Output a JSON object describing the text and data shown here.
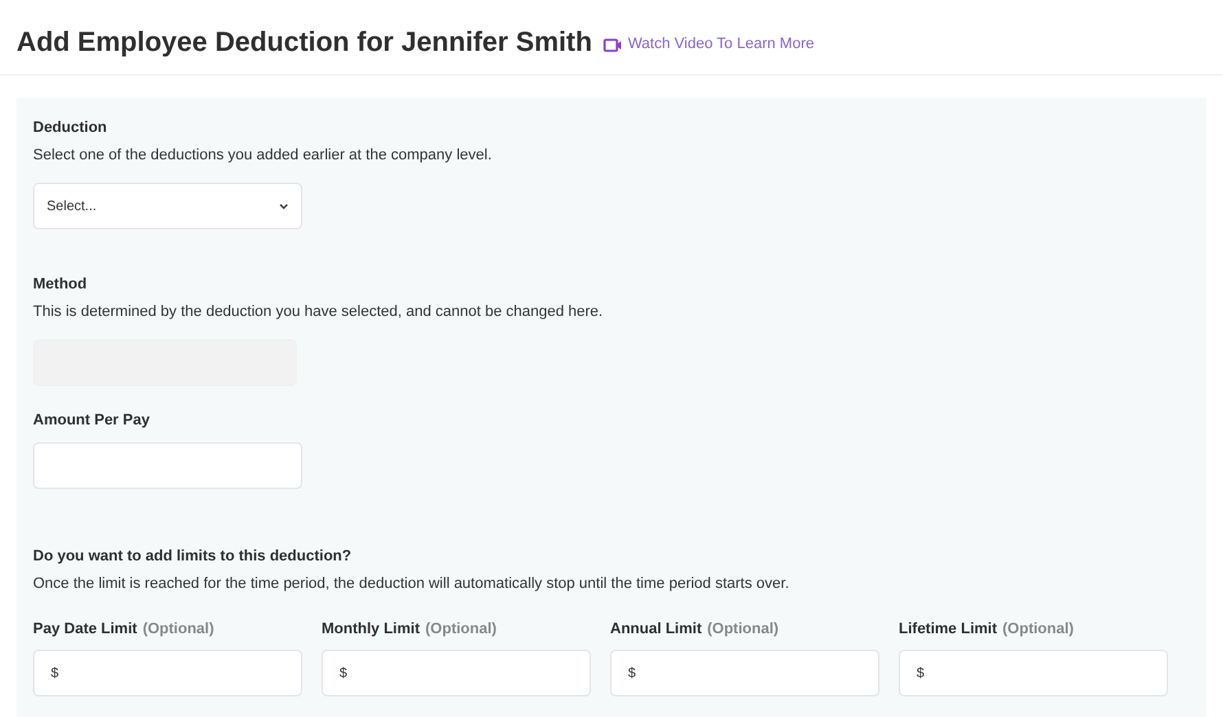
{
  "header": {
    "title": "Add Employee Deduction for Jennifer Smith",
    "video_link": "Watch Video To Learn More"
  },
  "deduction": {
    "label": "Deduction",
    "description": "Select one of the deductions you added earlier at the company level.",
    "select": {
      "value": "Select..."
    }
  },
  "method": {
    "label": "Method",
    "description": "This is determined by the deduction you have selected, and cannot be changed here.",
    "field": {
      "disabled": true
    }
  },
  "amount": {
    "label": "Amount Per Pay",
    "field": {
      "disabled": false
    }
  },
  "limits": {
    "heading": "Do you want to add limits to this deduction?",
    "description": "Once the limit is reached for the time period, the deduction will automatically stop until the time period starts over.",
    "fields": [
      {
        "label": "Pay Date Limit",
        "note": "(Optional)",
        "prefix": "$"
      },
      {
        "label": "Monthly Limit",
        "note": "(Optional)",
        "prefix": "$"
      },
      {
        "label": "Annual Limit",
        "note": "(Optional)",
        "prefix": "$"
      },
      {
        "label": "Lifetime Limit",
        "note": "(Optional)",
        "prefix": "$"
      }
    ]
  }
}
